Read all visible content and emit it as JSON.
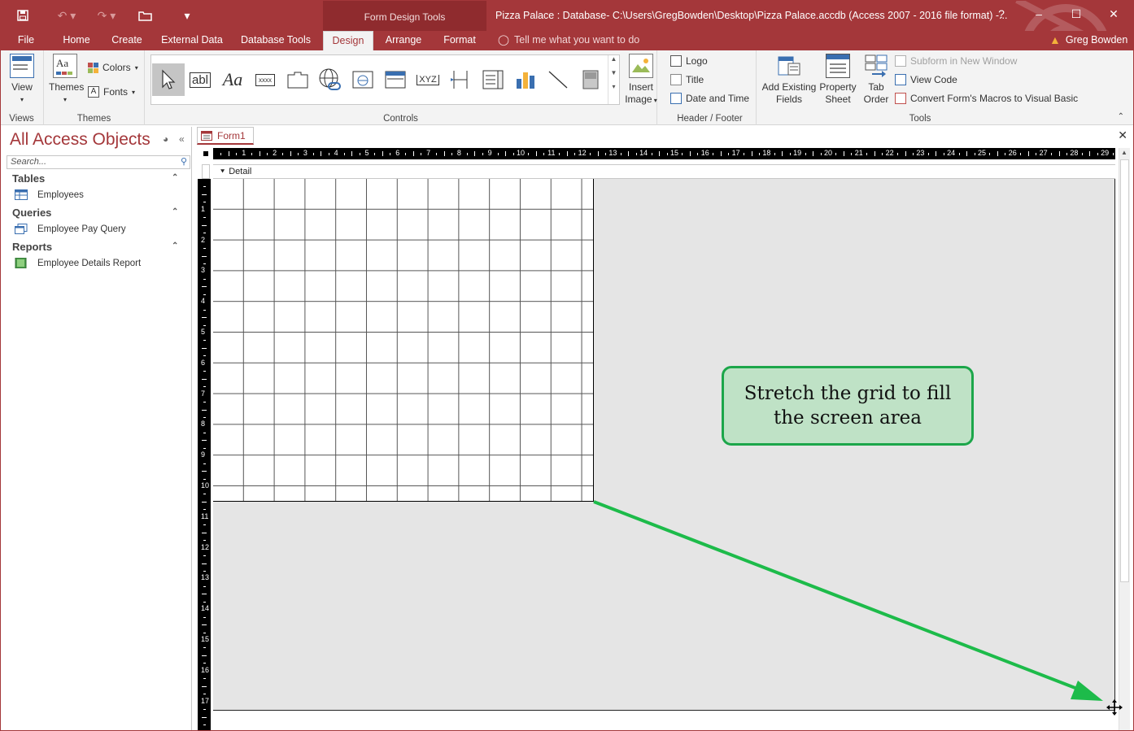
{
  "titlebar": {
    "context_label": "Form Design Tools",
    "window_title": "Pizza Palace : Database- C:\\Users\\GregBowden\\Desktop\\Pizza Palace.accdb (Access 2007 - 2016 file format) -...",
    "help": "?",
    "minimize": "–",
    "maximize": "☐",
    "close": "✕"
  },
  "tabs": [
    "File",
    "Home",
    "Create",
    "External Data",
    "Database Tools",
    "Design",
    "Arrange",
    "Format"
  ],
  "active_tab": "Design",
  "tell_me": "Tell me what you want to do",
  "user": "Greg Bowden",
  "ribbon": {
    "views": {
      "view_label": "View",
      "group_label": "Views"
    },
    "themes": {
      "themes_label": "Themes",
      "colors_label": "Colors",
      "fonts_label": "Fonts",
      "group_label": "Themes"
    },
    "controls": {
      "group_label": "Controls",
      "textbox_glyph": "abl",
      "label_glyph": "Aa",
      "button_glyph": "xxxx",
      "option_group_glyph": "XYZ"
    },
    "insert_image": {
      "line1": "Insert",
      "line2": "Image"
    },
    "header_footer": {
      "logo": "Logo",
      "title": "Title",
      "date_time": "Date and Time",
      "group_label": "Header / Footer"
    },
    "tools": {
      "add_existing_fields": "Add Existing Fields",
      "property_sheet": "Property Sheet",
      "tab_order": "Tab Order",
      "subform": "Subform in New Window",
      "view_code": "View Code",
      "convert_macros": "Convert Form's Macros to Visual Basic",
      "group_label": "Tools"
    }
  },
  "nav": {
    "title": "All Access Objects",
    "search_placeholder": "Search...",
    "sections": [
      {
        "label": "Tables",
        "items": [
          "Employees"
        ]
      },
      {
        "label": "Queries",
        "items": [
          "Employee Pay Query"
        ]
      },
      {
        "label": "Reports",
        "items": [
          "Employee Details Report"
        ]
      }
    ]
  },
  "document": {
    "tab_label": "Form1",
    "section_label": "Detail",
    "ruler_numbers": [
      "1",
      "2",
      "3",
      "4",
      "5",
      "6",
      "7",
      "8",
      "9",
      "10",
      "11",
      "12",
      "13",
      "14",
      "15",
      "16",
      "17",
      "18",
      "19",
      "20",
      "21",
      "22",
      "23",
      "24",
      "25",
      "26",
      "27",
      "28",
      "29"
    ],
    "vruler_numbers": [
      "1",
      "2",
      "3",
      "4",
      "5",
      "6",
      "7",
      "8",
      "9",
      "10",
      "11",
      "12",
      "13",
      "14",
      "15",
      "16",
      "17"
    ]
  },
  "callout": {
    "text": "Stretch the grid to fill the screen area"
  },
  "colors": {
    "accent": "#a4373a",
    "callout_fill": "#bfe2c6",
    "callout_border": "#1ca64a",
    "arrow": "#1dbb4a"
  }
}
